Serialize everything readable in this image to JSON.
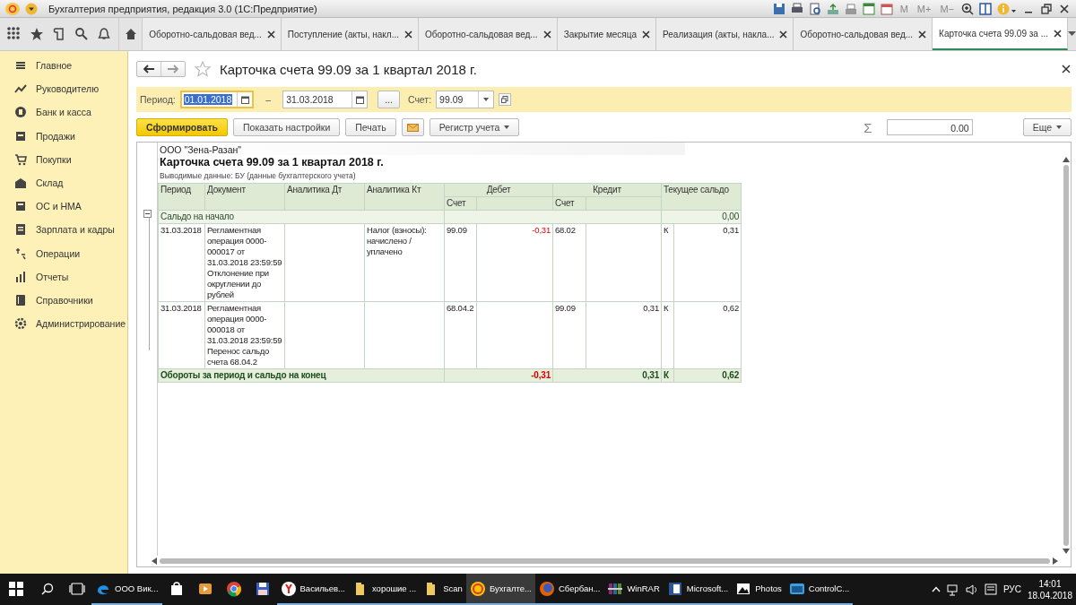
{
  "window": {
    "title": "Бухгалтерия предприятия, редакция 3.0  (1С:Предприятие)",
    "memory_buttons": [
      {
        "label": "M",
        "disabled": true
      },
      {
        "label": "M+",
        "disabled": true
      },
      {
        "label": "M−",
        "disabled": true
      }
    ]
  },
  "tabs": [
    {
      "label": "Оборотно-сальдовая вед...",
      "selected": false
    },
    {
      "label": "Поступление (акты, накл...",
      "selected": false
    },
    {
      "label": "Оборотно-сальдовая вед...",
      "selected": false
    },
    {
      "label": "Закрытие месяца",
      "selected": false
    },
    {
      "label": "Реализация (акты, накла...",
      "selected": false
    },
    {
      "label": "Оборотно-сальдовая вед...",
      "selected": false
    },
    {
      "label": "Карточка счета 99.09 за ...",
      "selected": true
    }
  ],
  "sidebar": {
    "items": [
      {
        "label": "Главное"
      },
      {
        "label": "Руководителю"
      },
      {
        "label": "Банк и касса"
      },
      {
        "label": "Продажи"
      },
      {
        "label": "Покупки"
      },
      {
        "label": "Склад"
      },
      {
        "label": "ОС и НМА"
      },
      {
        "label": "Зарплата и кадры"
      },
      {
        "label": "Операции"
      },
      {
        "label": "Отчеты"
      },
      {
        "label": "Справочники"
      },
      {
        "label": "Администрирование"
      }
    ]
  },
  "form": {
    "title": "Карточка счета 99.09 за 1 квартал 2018 г.",
    "period_label": "Период:",
    "date_separator": "–",
    "sum_sign": "Σ",
    "date_from": {
      "value": "01.01.2018",
      "focused": true
    },
    "date_to": {
      "value": "31.03.2018",
      "focused": false
    },
    "dots_button": "...",
    "account_label": "Счет:",
    "account": "99.09",
    "buttons": [
      {
        "kind": "primary",
        "label": "Сформировать"
      },
      {
        "kind": "plain",
        "label": "Показать настройки"
      },
      {
        "kind": "plain",
        "label": "Печать"
      },
      {
        "kind": "mail"
      },
      {
        "kind": "dropdown",
        "label": "Регистр учета"
      }
    ],
    "sum_value": "0.00",
    "more_button": "Еще"
  },
  "report": {
    "company": "ООО \"Зена-Разан\"",
    "title": "Карточка счета 99.09 за 1 квартал 2018 г.",
    "output_data": "Выводимые данные:  БУ (данные бухгалтерского учета)",
    "columns": [
      "Период",
      "Документ",
      "Аналитика Дт",
      "Аналитика Кт",
      "Дебет",
      "Кредит",
      "Текущее сальдо"
    ],
    "debit_subcolumn": "Счет",
    "credit_subcolumn": "Счет",
    "expanded": true,
    "opening": {
      "label": "Сальдо на начало",
      "balance": "0,00"
    },
    "rows": [
      {
        "period": "31.03.2018",
        "document": "Регламентная операция 0000-000017 от 31.03.2018 23:59:59 Отклонение при округлении до рублей",
        "analytics_dt": "",
        "analytics_kt": "Налог (взносы): начислено / уплачено",
        "debit_account": "99.09",
        "debit_amount": "-0,31",
        "debit_negative": true,
        "credit_account": "68.02",
        "credit_amount": "",
        "balance_side": "К",
        "balance": "0,31"
      },
      {
        "period": "31.03.2018",
        "document": "Регламентная операция 0000-000018 от 31.03.2018 23:59:59 Перенос сальдо счета 68.04.2",
        "analytics_dt": "",
        "analytics_kt": "",
        "debit_account": "68.04.2",
        "debit_amount": "",
        "credit_account": "99.09",
        "credit_amount": "0,31",
        "balance_side": "К",
        "balance": "0,62"
      }
    ],
    "total": {
      "label": "Обороты за период и сальдо на конец",
      "debit": "-0,31",
      "debit_negative": true,
      "credit": "0,31",
      "balance_side": "К",
      "balance": "0,62"
    }
  },
  "taskbar": {
    "items": [
      {
        "label": "ООО Вик...",
        "running": true,
        "selected": false
      },
      {
        "running": false,
        "selected": false
      },
      {
        "running": false,
        "selected": false
      },
      {
        "running": false,
        "selected": false
      },
      {
        "running": false,
        "selected": false
      },
      {
        "label": "Васильев...",
        "running": true,
        "selected": false
      },
      {
        "label": "хорошие ...",
        "running": true,
        "selected": false
      },
      {
        "label": "Scan",
        "running": true,
        "selected": false
      },
      {
        "label": "Бухгалте...",
        "running": true,
        "selected": true
      },
      {
        "label": "Сбербан...",
        "running": true,
        "selected": false
      },
      {
        "label": "WinRAR",
        "running": true,
        "selected": false
      },
      {
        "label": "Microsoft...",
        "running": true,
        "selected": false
      },
      {
        "label": "Photos",
        "running": true,
        "selected": false
      },
      {
        "label": "ControlC...",
        "running": true,
        "selected": false
      }
    ],
    "language": "РУС",
    "time": "14:01",
    "date": "18.04.2018"
  }
}
